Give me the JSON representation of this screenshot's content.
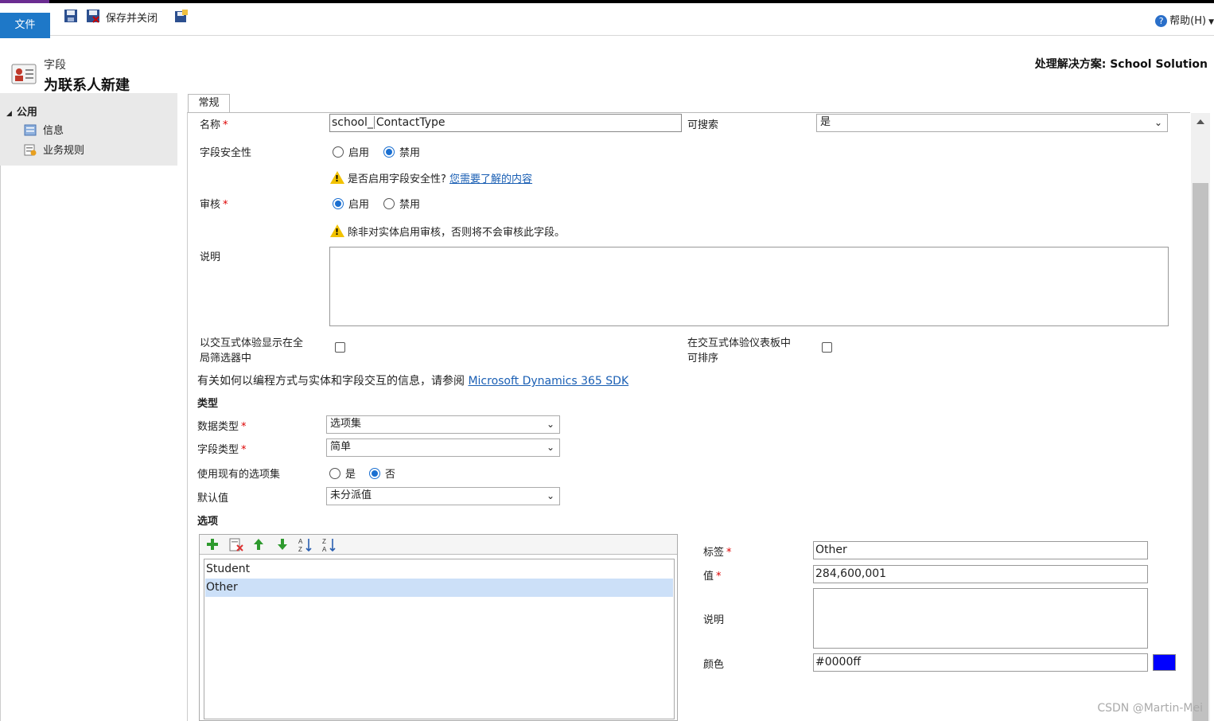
{
  "ribbon": {
    "file_tab": "文件",
    "save_close_label": "保存并关闭",
    "help_label": "帮助(H)"
  },
  "header": {
    "entity_label": "字段",
    "title": "为联系人新建",
    "solution": "处理解决方案: School Solution"
  },
  "sidenav": {
    "group": "公用",
    "items": [
      {
        "label": "信息",
        "icon": "info-icon"
      },
      {
        "label": "业务规则",
        "icon": "business-rules-icon"
      }
    ]
  },
  "tabs": [
    {
      "label": "常规"
    }
  ],
  "general": {
    "name_label": "名称",
    "name_prefix": "school_",
    "name_value": "ContactType",
    "searchable_label": "可搜索",
    "searchable_value": "是",
    "field_security_label": "字段安全性",
    "field_security_options": [
      "启用",
      "禁用"
    ],
    "field_security_selected": "禁用",
    "security_warning": "是否启用字段安全性?",
    "security_link": "您需要了解的内容",
    "audit_label": "审核",
    "audit_options": [
      "启用",
      "禁用"
    ],
    "audit_selected": "启用",
    "audit_warning": "除非对实体启用审核，否则将不会审核此字段。",
    "description_label": "说明",
    "global_filter_label_line1": "以交互式体验显示在全",
    "global_filter_label_line2": "局筛选器中",
    "sortable_label_line1": "在交互式体验仪表板中",
    "sortable_label_line2": "可排序",
    "sdk_text": "有关如何以编程方式与实体和字段交互的信息，请参阅",
    "sdk_link": "Microsoft Dynamics 365 SDK"
  },
  "type_section": {
    "heading": "类型",
    "data_type_label": "数据类型",
    "data_type_value": "选项集",
    "field_type_label": "字段类型",
    "field_type_value": "简单",
    "use_existing_label": "使用现有的选项集",
    "use_existing_options": [
      "是",
      "否"
    ],
    "use_existing_selected": "否",
    "default_label": "默认值",
    "default_value": "未分派值"
  },
  "options_section": {
    "heading": "选项",
    "items": [
      "Student",
      "Other"
    ],
    "selected_index": 1,
    "label_label": "标签",
    "label_value": "Other",
    "value_label": "值",
    "value_value": "284,600,001",
    "description_label": "说明",
    "color_label": "颜色",
    "color_value": "#0000ff"
  },
  "watermark": "CSDN @Martin-Mei",
  "colors": {
    "accent": "#1e78c8",
    "selected_row": "#cce0f8",
    "swatch": "#0000ff",
    "required": "#dd0000"
  }
}
